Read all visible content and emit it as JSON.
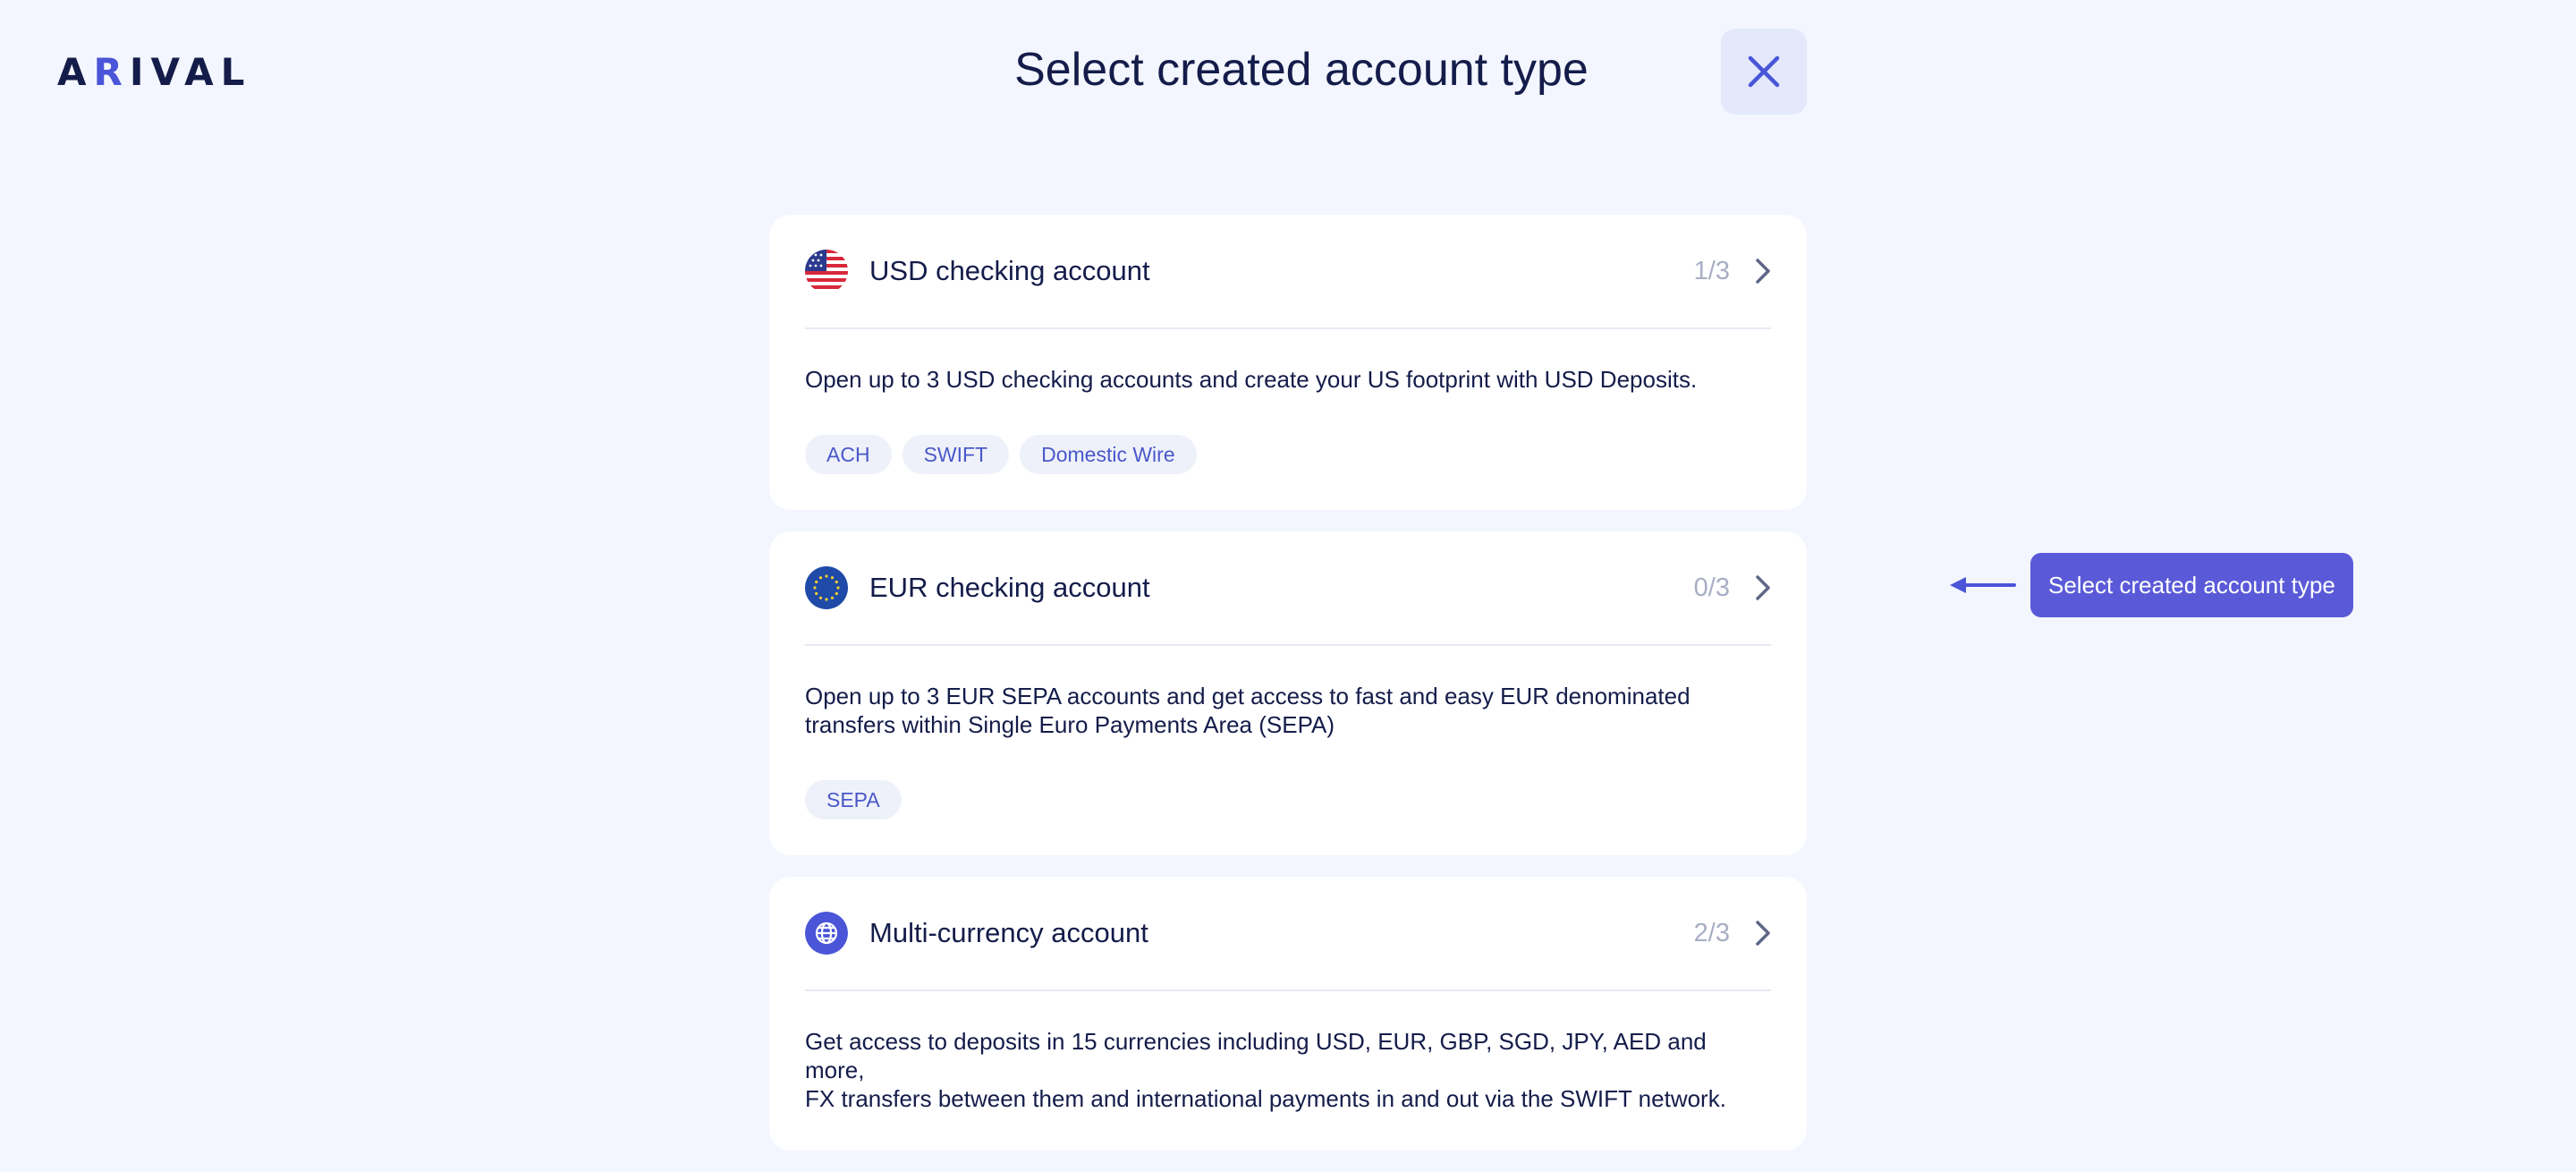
{
  "header": {
    "logo_prefix": "A",
    "logo_accent": "R",
    "logo_suffix": "IVAL",
    "title": "Select created account type",
    "close_icon": "close-icon"
  },
  "accounts": [
    {
      "title": "USD checking account",
      "count": "1/3",
      "icon": "us-flag-icon",
      "description": "Open up to 3 USD checking accounts and create your US footprint with USD Deposits.",
      "tags": [
        "ACH",
        "SWIFT",
        "Domestic Wire"
      ]
    },
    {
      "title": "EUR checking account",
      "count": "0/3",
      "icon": "eu-flag-icon",
      "description_line1": "Open up to 3 EUR SEPA accounts and get access to fast and easy EUR denominated",
      "description_line2": "transfers within Single Euro Payments Area (SEPA)",
      "tags": [
        "SEPA"
      ]
    },
    {
      "title": "Multi-currency account",
      "count": "2/3",
      "icon": "globe-icon",
      "description_line1": "Get access to deposits in 15 currencies including USD, EUR, GBP, SGD, JPY, AED and more,",
      "description_line2": "FX transfers between them and international payments in and out via the SWIFT network.",
      "tags": []
    }
  ],
  "hint": {
    "label": "Select created account type",
    "icon": "arrow-left-icon"
  },
  "colors": {
    "background": "#f3f6fe",
    "accent": "#4a55d8",
    "hint_badge": "#5a5ad8",
    "text": "#141c4a",
    "muted": "#a8aec4"
  }
}
